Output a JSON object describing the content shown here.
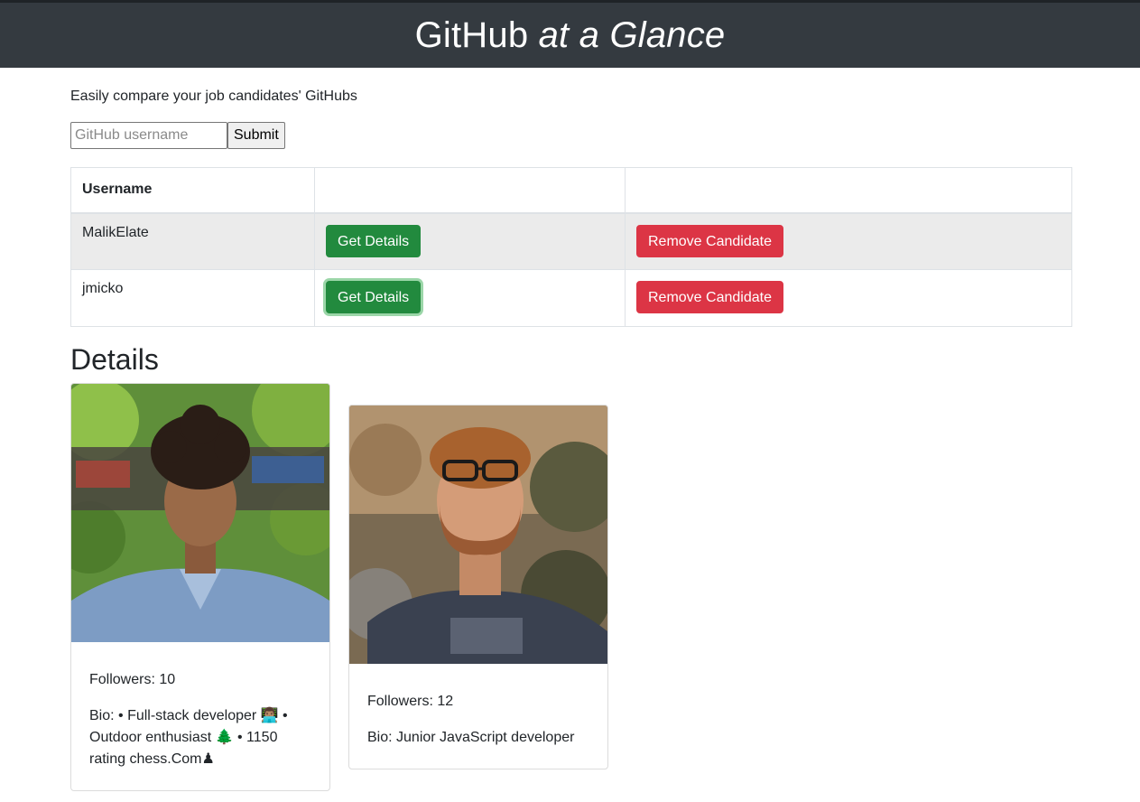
{
  "header": {
    "title_prefix": "GitHub ",
    "title_italic": "at a Glance"
  },
  "tagline": "Easily compare your job candidates' GitHubs",
  "search": {
    "placeholder": "GitHub username",
    "value": "",
    "submit_label": "Submit"
  },
  "table": {
    "headers": [
      "Username",
      "",
      ""
    ],
    "rows": [
      {
        "username": "MalikElate",
        "details_label": "Get Details",
        "remove_label": "Remove Candidate"
      },
      {
        "username": "jmicko",
        "details_label": "Get Details",
        "remove_label": "Remove Candidate"
      }
    ]
  },
  "details": {
    "title": "Details",
    "cards": [
      {
        "followers": "Followers: 10",
        "bio": "Bio: • Full-stack developer 👨🏽‍💻 • Outdoor enthusiast 🌲 • 1150 rating chess.Com♟",
        "avatar": "person-photo"
      },
      {
        "followers": "Followers: 12",
        "bio": "Bio: Junior JavaScript developer",
        "avatar": "person-photo"
      }
    ]
  },
  "colors": {
    "header_bg": "#343a40",
    "success": "#228a3e",
    "danger": "#dc3545",
    "row_shade": "#ebebeb"
  }
}
